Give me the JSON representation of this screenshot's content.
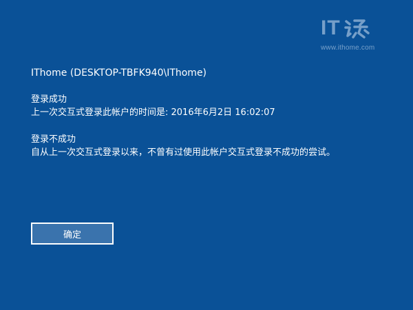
{
  "watermark": {
    "logo_text": "IT",
    "glyph_icon": "ithome-logo-glyph",
    "url": "www.ithome.com"
  },
  "account": {
    "name": "IThome (DESKTOP-TBFK940\\IThome)"
  },
  "success": {
    "title": "登录成功",
    "detail": "上一次交互式登录此帐户的时间是: 2016年6月2日 16:02:07"
  },
  "failure": {
    "title": "登录不成功",
    "detail": "自从上一次交互式登录以来，不曾有过使用此帐户交互式登录不成功的尝试。"
  },
  "buttons": {
    "ok_label": "确定"
  },
  "colors": {
    "background": "#0a5197",
    "button_fill": "#3a73ad",
    "text": "#ffffff"
  }
}
